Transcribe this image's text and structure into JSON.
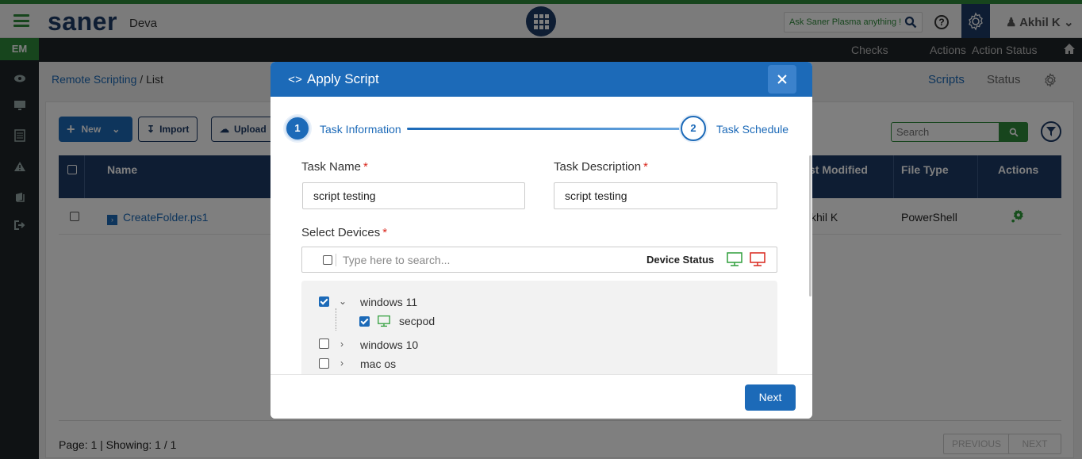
{
  "header": {
    "logo": "saner",
    "tenant": "Deva",
    "ask_placeholder": "Ask Saner Plasma anything !",
    "user_name": "Akhil K"
  },
  "sidebar": {
    "badge": "EM",
    "icons": [
      "eye-icon",
      "monitor-icon",
      "list-icon",
      "warning-icon",
      "book-icon",
      "logout-icon"
    ]
  },
  "subnav": {
    "items": [
      "Checks",
      "Actions",
      "Action Status"
    ]
  },
  "pagebar": {
    "crumb_link": "Remote Scripting",
    "crumb_sep": " / ",
    "crumb_current": "List",
    "tabs": [
      "Scripts",
      "Status"
    ]
  },
  "toolbar": {
    "new_label": "New",
    "import_label": "Import",
    "upload_label": "Upload",
    "search_placeholder": "Search"
  },
  "table": {
    "columns": [
      "Name",
      "st Modified",
      "File Type",
      "Actions"
    ],
    "rows": [
      {
        "name": "CreateFolder.ps1",
        "modified_by": "khil K",
        "file_type": "PowerShell"
      }
    ]
  },
  "pager": {
    "text": "Page: 1 | Showing: 1 / 1",
    "previous": "PREVIOUS",
    "next": "NEXT"
  },
  "modal": {
    "title_icon": "<>",
    "title": "Apply Script",
    "steps": [
      {
        "number": "1",
        "label": "Task Information"
      },
      {
        "number": "2",
        "label": "Task Schedule"
      }
    ],
    "task_name_label": "Task Name",
    "task_name_value": "script testing",
    "task_desc_label": "Task Description",
    "task_desc_value": "script testing",
    "select_devices_label": "Select Devices",
    "required_mark": "*",
    "device_search_placeholder": "Type here to search...",
    "device_status_label": "Device Status",
    "tree": [
      {
        "label": "windows 11",
        "checked": true,
        "expanded": true
      },
      {
        "label": "secpod",
        "checked": true,
        "child": true
      },
      {
        "label": "windows 10",
        "checked": false,
        "expanded": false
      },
      {
        "label": "mac os",
        "checked": false,
        "expanded": false
      }
    ],
    "next_label": "Next"
  },
  "colors": {
    "brand_green": "#2e8b3a",
    "brand_navy": "#1d3a66",
    "primary_blue": "#1c6ab8",
    "online_green": "#2e9e3a",
    "offline_red": "#d9261c"
  }
}
